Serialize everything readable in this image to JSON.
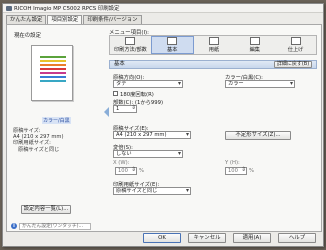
{
  "window": {
    "title": "RICOH Imagio MP C5002 RPCS 印刷設定"
  },
  "tabs": [
    {
      "label": "かんたん設定"
    },
    {
      "label": "項目別設定"
    },
    {
      "label": "印刷条件/バージョン"
    }
  ],
  "left": {
    "group_label": "現在の設定",
    "preview_stripes": [
      "#5ba33c",
      "#e8c22a",
      "#ea7d2a",
      "#d93a3a",
      "#c63a8f",
      "#3a7cd6",
      "#38a7c4"
    ],
    "color_link": "カラー/白黒",
    "summary_lines": [
      "原稿サイズ:",
      "A4 (210 x 297 mm)",
      "印刷用紙サイズ:",
      "原稿サイズと同じ"
    ],
    "list_button": "設定内容一覧(L)...",
    "info_text": "かんたん設定(ワンタッチ)..."
  },
  "right": {
    "menu_label": "メニュー項目(I):",
    "menu_items": [
      {
        "label": "印刷方法/部数"
      },
      {
        "label": "基本"
      },
      {
        "label": "用紙"
      },
      {
        "label": "編集"
      },
      {
        "label": "仕上げ"
      }
    ],
    "section_title": "基本",
    "section_button": "詳細に戻す(B)",
    "orientation": {
      "label": "原稿方向(O):",
      "value": "タテ"
    },
    "rotate_check": "180度回転(R)",
    "copies": {
      "label": "部数(C): (1から999)",
      "value": "1"
    },
    "color_mode": {
      "label": "カラー/白黒(C):",
      "value": "カラー"
    },
    "original_size": {
      "label": "原稿サイズ(E):",
      "value": "A4 (210 x 297 mm)"
    },
    "custom_size_button": "不定形サイズ(Z)...",
    "magnification": {
      "label": "変倍(S):",
      "value": "しない"
    },
    "mag_values": {
      "x_label": "X (W):",
      "x": "100",
      "y_label": "Y (H):",
      "y": "100",
      "unit": "%"
    },
    "paper_size": {
      "label": "印刷用紙サイズ(E):",
      "value": "原稿サイズと同じ"
    }
  },
  "footer": {
    "ok": "OK",
    "cancel": "キャンセル",
    "apply": "適用(A)",
    "help": "ヘルプ"
  }
}
